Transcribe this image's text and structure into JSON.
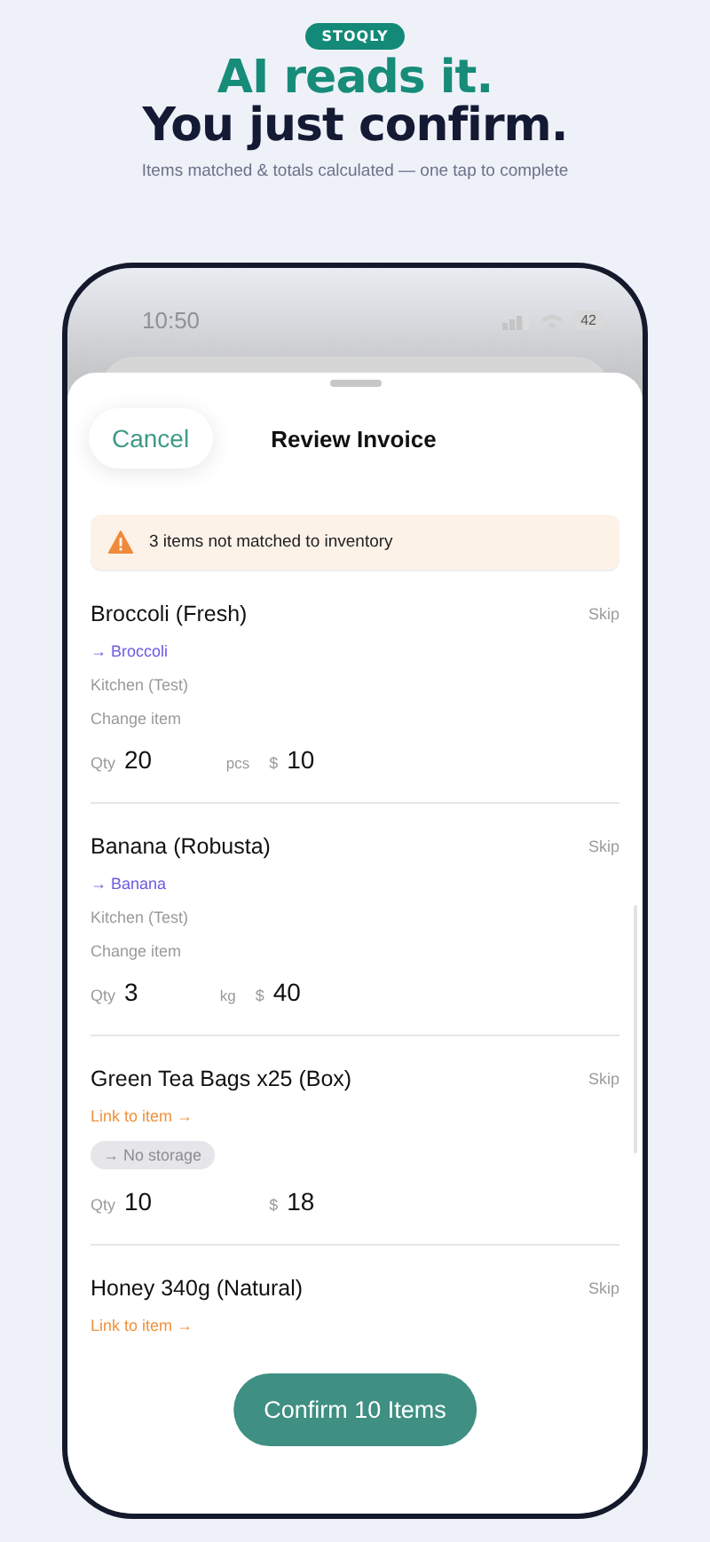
{
  "header": {
    "badge": "STOQLY",
    "headline_accent": "AI reads it.",
    "headline": "You just confirm.",
    "subtitle": "Items matched & totals calculated — one tap to complete"
  },
  "status_bar": {
    "time": "10:50",
    "battery": "42"
  },
  "sheet": {
    "cancel": "Cancel",
    "title": "Review Invoice",
    "warning": "3 items not matched to inventory"
  },
  "items": [
    {
      "kind": "matched",
      "name": "Broccoli (Fresh)",
      "skip": "Skip",
      "link": "→ Broccoli",
      "storage": "Kitchen (Test)",
      "change": "Change item",
      "qty_label": "Qty",
      "qty": "20",
      "unit": "pcs",
      "currency": "$",
      "price": "10"
    },
    {
      "kind": "matched",
      "name": "Banana (Robusta)",
      "skip": "Skip",
      "link": "→ Banana",
      "storage": "Kitchen (Test)",
      "change": "Change item",
      "qty_label": "Qty",
      "qty": "3",
      "unit": "kg",
      "currency": "$",
      "price": "40"
    },
    {
      "kind": "unmatched",
      "name": "Green Tea Bags x25 (Box)",
      "skip": "Skip",
      "link": "Link to item →",
      "storage": "→ No storage",
      "qty_label": "Qty",
      "qty": "10",
      "currency": "$",
      "price": "18"
    },
    {
      "kind": "unmatched",
      "name": "Honey 340g (Natural)",
      "skip": "Skip",
      "link": "Link to item →"
    }
  ],
  "confirm": "Confirm 10 Items"
}
